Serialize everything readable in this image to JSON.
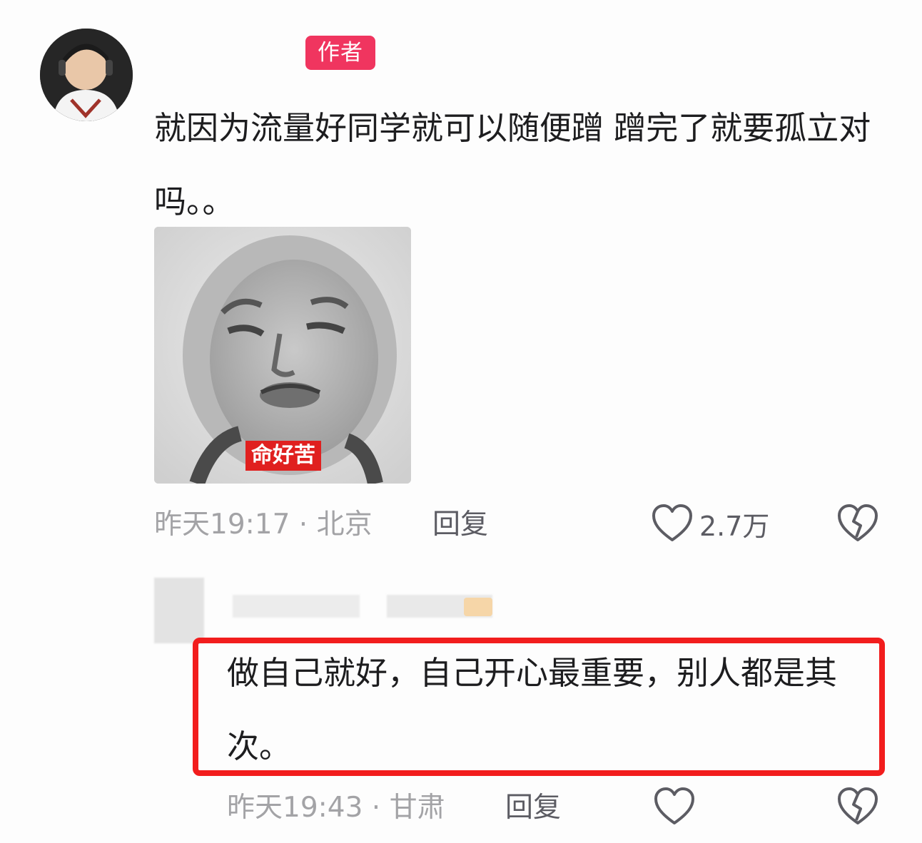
{
  "comment": {
    "author_badge": "作者",
    "text": "就因为流量好同学就可以随便蹭 蹭完了就要孤立对吗。。",
    "sticker_caption": "命好苦",
    "time_location": "昨天19:17 · 北京",
    "reply_label": "回复",
    "like_count": "2.7万"
  },
  "reply": {
    "text": "做自己就好，自己开心最重要，别人都是其次。",
    "time_location": "昨天19:43 · 甘肃",
    "reply_label": "回复"
  },
  "colors": {
    "author_badge": "#f0355f",
    "highlight_border": "#f21d1d",
    "meta_text": "#a3a3a6"
  }
}
